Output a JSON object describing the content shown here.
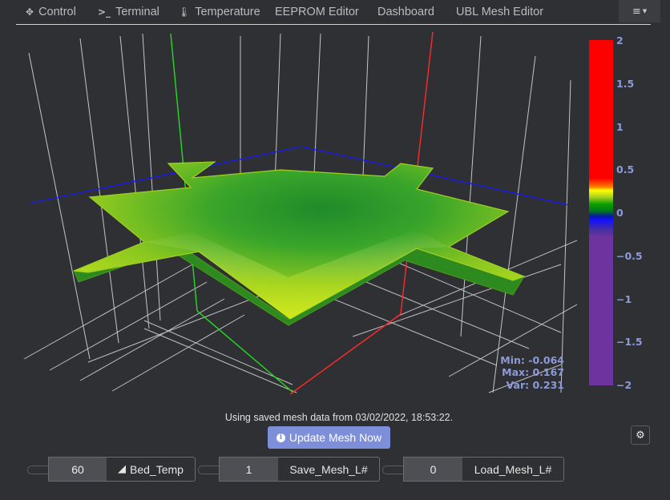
{
  "nav": {
    "items": [
      {
        "label": "Control",
        "icon": "move-icon"
      },
      {
        "label": "Terminal",
        "icon": "terminal-icon"
      },
      {
        "label": "Temperature",
        "icon": "thermometer-icon"
      },
      {
        "label": "EEPROM Editor",
        "icon": ""
      },
      {
        "label": "Dashboard",
        "icon": ""
      },
      {
        "label": "UBL Mesh Editor",
        "icon": ""
      }
    ],
    "menu_icon": "hamburger-icon"
  },
  "colorbar": {
    "ticks": [
      "2",
      "1.5",
      "1",
      "0.5",
      "0",
      "−0.5",
      "−1",
      "−1.5",
      "−2"
    ],
    "min": -2,
    "max": 2
  },
  "stats": {
    "min": "Min: -0.064",
    "max": "Max: 0.167",
    "var": "Var: 0.231"
  },
  "message": "Using saved mesh data from 03/02/2022, 18:53:22.",
  "update_button": "Update Mesh Now",
  "controls": [
    {
      "value": "60",
      "label": "Bed_Temp",
      "icon": "area-chart-icon"
    },
    {
      "value": "1",
      "label": "Save_Mesh_L#",
      "icon": ""
    },
    {
      "value": "0",
      "label": "Load_Mesh_L#",
      "icon": ""
    }
  ],
  "colors": {
    "background": "#2f3033",
    "accent": "#7e8fd9",
    "axis_x": "#ff2a2a",
    "axis_y": "#22dd22",
    "axis_z": "#1a1aee"
  }
}
